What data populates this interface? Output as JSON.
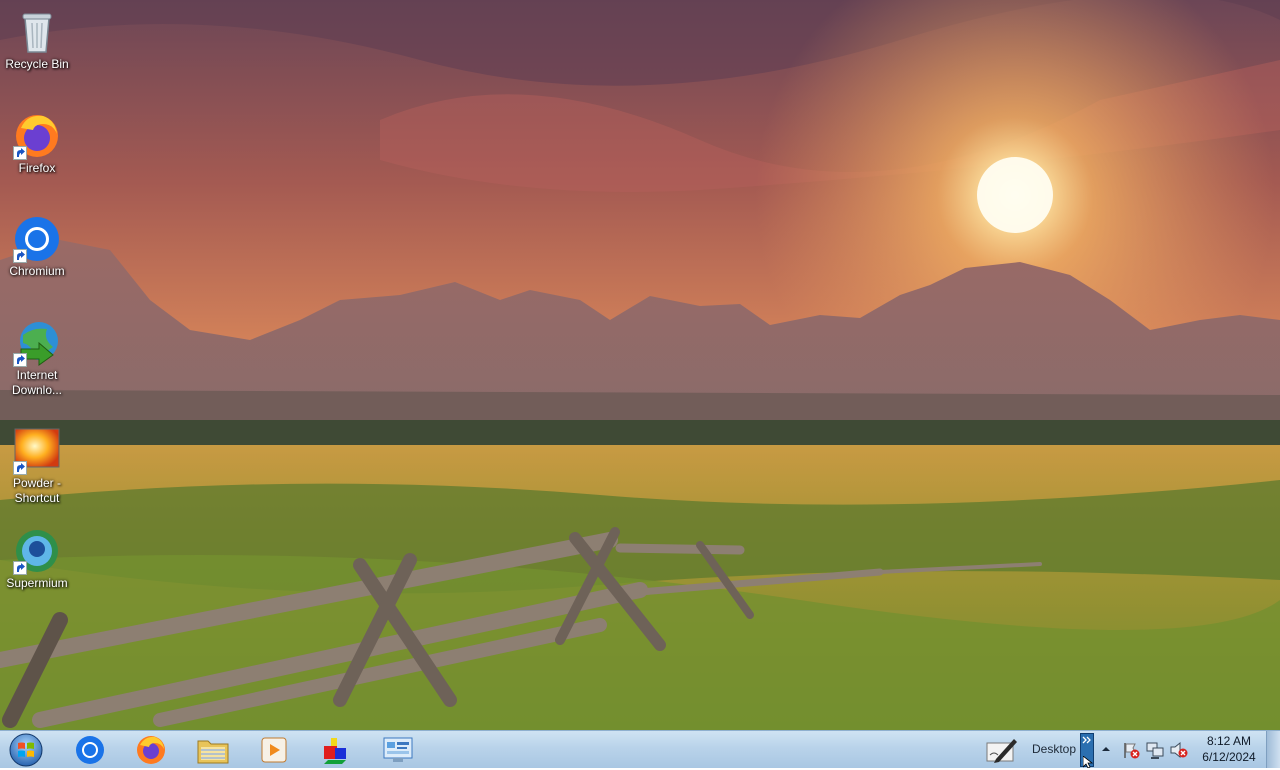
{
  "desktop": {
    "icons": [
      {
        "label_line1": "Recycle Bin",
        "label_line2": "",
        "icon": "recycle-bin-icon"
      },
      {
        "label_line1": "Firefox",
        "label_line2": "",
        "icon": "firefox-icon"
      },
      {
        "label_line1": "Chromium",
        "label_line2": "",
        "icon": "chromium-icon"
      },
      {
        "label_line1": "Internet",
        "label_line2": "Downlo...",
        "icon": "internet-download-manager-icon"
      },
      {
        "label_line1": "Powder -",
        "label_line2": "Shortcut",
        "icon": "powder-icon"
      },
      {
        "label_line1": "Supermium",
        "label_line2": "",
        "icon": "supermium-icon"
      }
    ]
  },
  "taskbar": {
    "start_icon": "windows-start-icon",
    "pinned": [
      "chromium-icon",
      "firefox-icon",
      "file-explorer-icon",
      "media-player-icon",
      "paint-3d-shapes-icon",
      "control-panel-icon"
    ],
    "toolbar_label": "Desktop",
    "tray_icons": [
      "pen-notepad-icon",
      "chevron-expand-icon",
      "up-arrow-icon",
      "action-center-flag-icon",
      "network-icon",
      "volume-muted-icon"
    ],
    "time": "8:12 AM",
    "date": "6/12/2024"
  },
  "colors": {
    "taskbar_top": "#cfe3f3",
    "taskbar_bottom": "#a9c7e3",
    "sky_glow": "#f0a35a"
  }
}
